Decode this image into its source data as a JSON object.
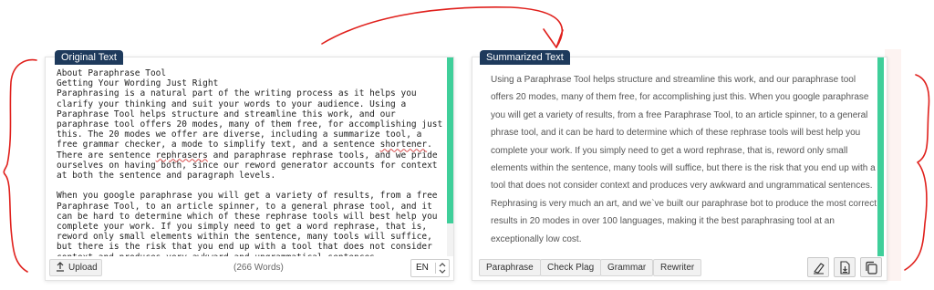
{
  "left_panel": {
    "label": "Original Text",
    "text_lines": [
      "About Paraphrase Tool",
      "Getting Your Wording Just Right",
      "Paraphrasing is a natural part of the writing process as it helps you clarify your thinking and suit your words to your audience. Using a Paraphrase Tool helps structure and streamline this work, and our paraphrase tool offers 20 modes, many of them free, for accomplishing just this. The 20 modes we offer are diverse, including a summarize tool, a free grammar checker, a mode to simplify text, and a sentence "
    ],
    "squiggle_word_1": "shortener",
    "text_mid_1": ". There are sentence ",
    "squiggle_word_2": "rephrasers",
    "text_mid_2": " and paraphrase rephrase tools, and we pride ourselves on having both, since our reword generator accounts for context at both the sentence and paragraph levels.",
    "paragraph_2": "When you google paraphrase you will get a variety of results, from a free Paraphrase Tool, to an article spinner, to a general phrase tool, and it can be hard to determine which of these rephrase tools will best help you complete your work. If you simply need to get a word rephrase, that is, reword only small elements within the sentence, many tools will suffice, but there is the risk that you end up with a tool that does not consider context and produces very awkward and ungrammatical sentences.",
    "upload_label": "Upload",
    "word_count": "(266 Words)",
    "language": "EN"
  },
  "right_panel": {
    "label": "Summarized Text",
    "summary": "Using a Paraphrase Tool helps structure and streamline this work, and our paraphrase tool offers 20 modes, many of them free, for accomplishing just this.  When you google paraphrase you will get a variety of results, from a free Paraphrase Tool, to an article spinner, to a general phrase tool, and it can be hard to determine which of these rephrase tools will best help you complete your work.  If you simply need to get a word rephrase, that is, reword only small elements within the sentence, many tools will suffice, but there is the risk that you end up with a tool that does not consider context and produces very awkward and ungrammatical sentences.  Rephrasing is very much an art, and we`ve built our paraphrase bot to produce the most correct results in 20 modes in over 100 languages, making it the best paraphrasing tool at an exceptionally low cost.",
    "buttons": [
      "Paraphrase",
      "Check Plag",
      "Grammar",
      "Rewriter"
    ]
  },
  "icons": {
    "upload": "upload-icon",
    "language_stepper": "chevron-updown-icon",
    "clear": "eraser-icon",
    "download": "download-icon",
    "copy": "copy-icon"
  },
  "colors": {
    "label_bg": "#1e3a5c",
    "scrollbar_accent": "#3fcf9a",
    "annotation_red": "#e0201c"
  }
}
